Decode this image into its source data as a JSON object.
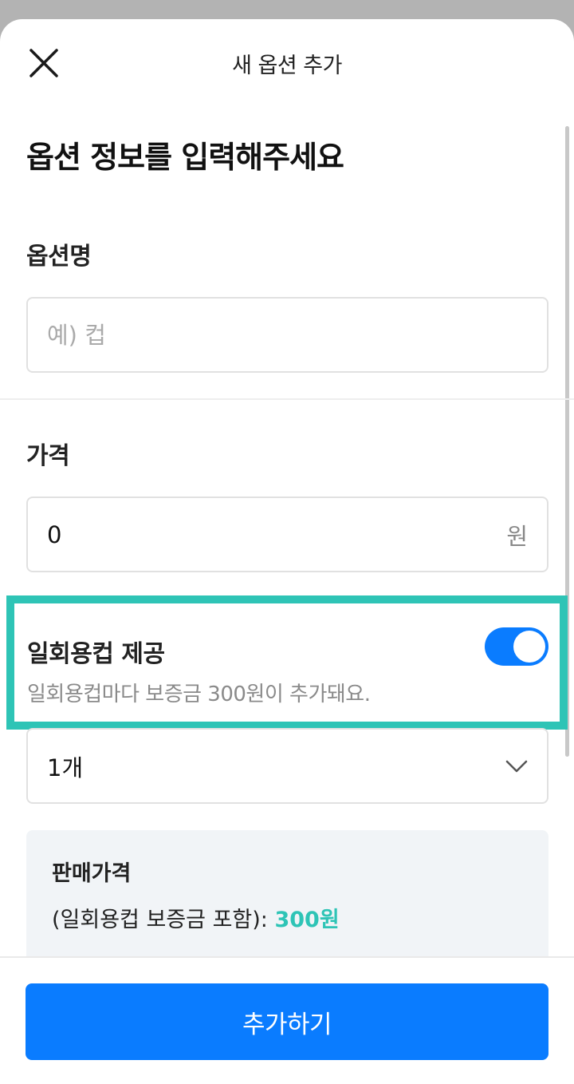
{
  "header": {
    "title": "새 옵션 추가",
    "close_icon": "close-icon"
  },
  "heading": "옵션 정보를 입력해주세요",
  "option_name": {
    "label": "옵션명",
    "value": "",
    "placeholder": "예) 컵"
  },
  "price": {
    "label": "가격",
    "value": "0",
    "unit": "원"
  },
  "disposable_cup": {
    "title": "일회용컵 제공",
    "description": "일회용컵마다 보증금 300원이 추가돼요.",
    "enabled": true
  },
  "quantity_select": {
    "value": "1개",
    "icon": "chevron-down-icon"
  },
  "summary": {
    "label": "판매가격",
    "line_prefix": "(일회용컵 보증금 포함): ",
    "amount": "300원"
  },
  "submit_label": "추가하기",
  "colors": {
    "accent": "#0a7cff",
    "highlight": "#2ec4b6"
  }
}
